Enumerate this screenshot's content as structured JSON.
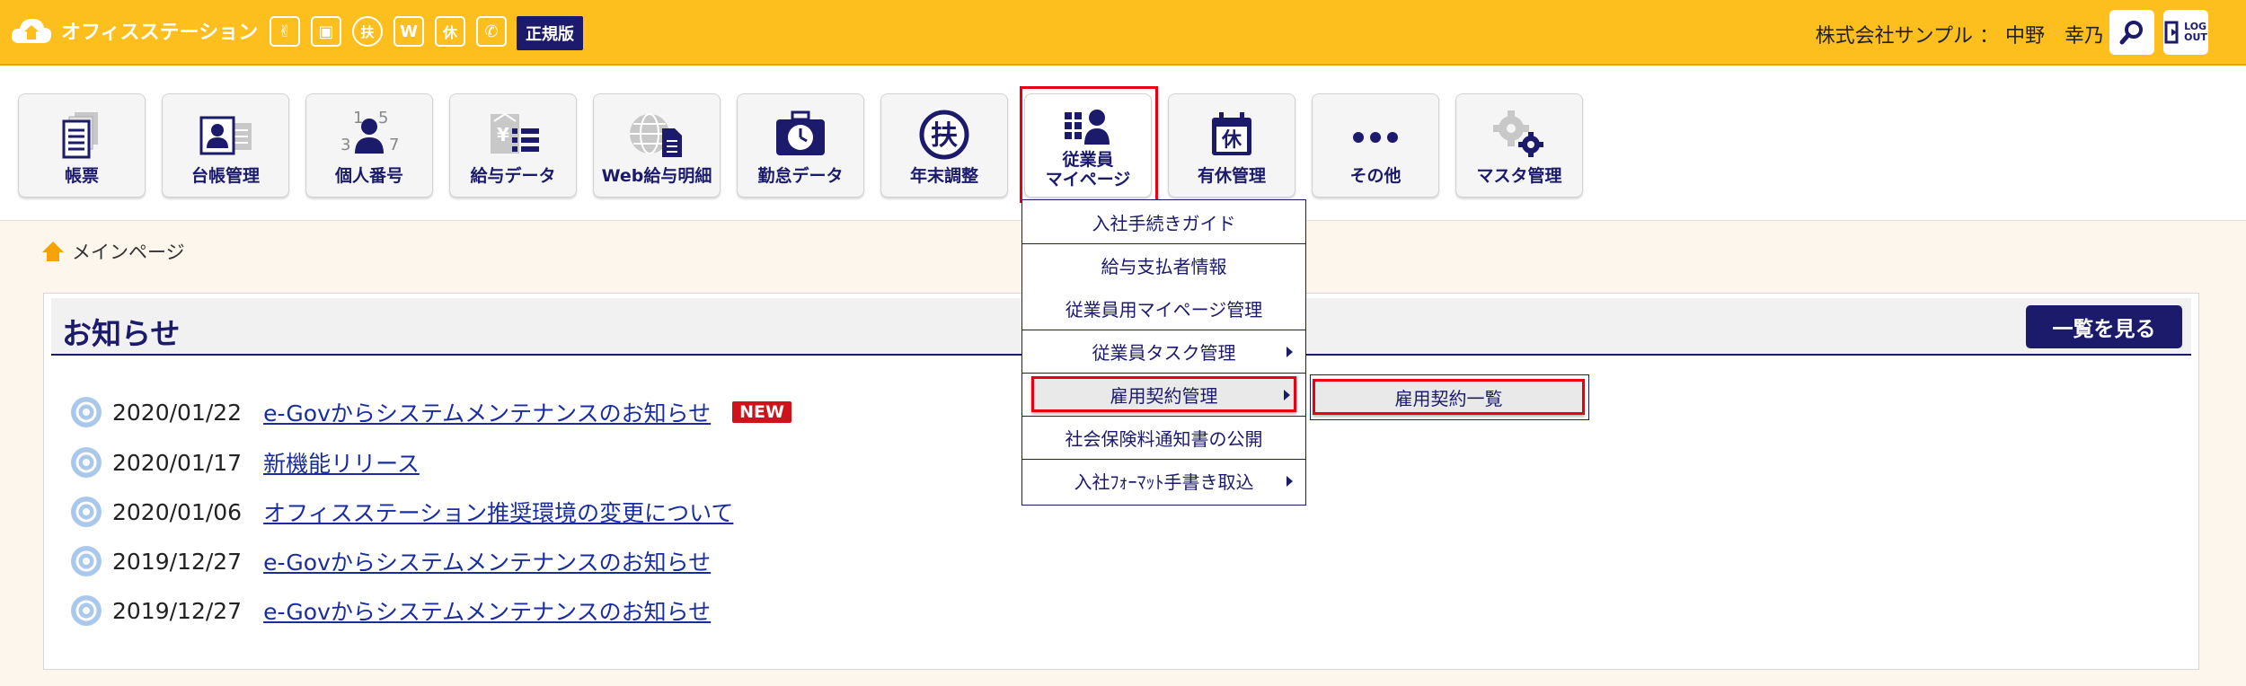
{
  "header": {
    "app_name": "オフィスステーション",
    "product_icons": [
      {
        "name": "victory-hand-icon",
        "glyph": "✌"
      },
      {
        "name": "briefcase-icon",
        "glyph": "▣"
      },
      {
        "name": "fu-icon",
        "glyph": "扶"
      },
      {
        "name": "web-payslip-icon",
        "glyph": "W"
      },
      {
        "name": "kyu-icon",
        "glyph": "休"
      },
      {
        "name": "phone-icon",
        "glyph": "✆"
      }
    ],
    "edition_badge": "正規版",
    "user": "株式会社サンプル ： 中野　幸乃",
    "logout_line1": "LOG",
    "logout_line2": "OUT",
    "accent_color": "#fcbf1e",
    "brand_color": "#1b1a6b"
  },
  "toolbar": {
    "items": [
      {
        "label": "帳票",
        "icon": "document-icon"
      },
      {
        "label": "台帳管理",
        "icon": "ledger-icon"
      },
      {
        "label": "個人番号",
        "icon": "personal-number-icon"
      },
      {
        "label": "給与データ",
        "icon": "salary-data-icon"
      },
      {
        "label": "Web給与明細",
        "icon": "web-payslip-icon"
      },
      {
        "label": "勤怠データ",
        "icon": "attendance-icon"
      },
      {
        "label": "年末調整",
        "icon": "year-end-icon"
      },
      {
        "label_line1": "従業員",
        "label_line2": "マイページ",
        "icon": "employee-mypage-icon",
        "active": true
      },
      {
        "label": "有休管理",
        "icon": "paid-leave-icon"
      },
      {
        "label": "その他",
        "icon": "more-icon"
      },
      {
        "label": "マスタ管理",
        "icon": "master-settings-icon"
      }
    ]
  },
  "dropdown": {
    "items": [
      {
        "label": "入社手続きガイド"
      },
      {
        "label": "給与支払者情報"
      },
      {
        "label": "従業員用マイページ管理"
      },
      {
        "label": "従業員タスク管理",
        "has_submenu": true
      },
      {
        "label": "雇用契約管理",
        "has_submenu": true,
        "highlighted": true
      },
      {
        "label": "社会保険料通知書の公開"
      },
      {
        "label": "入社ﾌｫｰﾏｯﾄ手書き取込",
        "has_submenu": true
      }
    ],
    "submenu": {
      "label": "雇用契約一覧"
    }
  },
  "breadcrumb": {
    "label": "メインページ"
  },
  "news": {
    "title": "お知らせ",
    "view_all": "一覧を見る",
    "new_badge": "NEW",
    "items": [
      {
        "date": "2020/01/22",
        "title": "e-Govからシステムメンテナンスのお知らせ",
        "is_new": true
      },
      {
        "date": "2020/01/17",
        "title": "新機能リリース"
      },
      {
        "date": "2020/01/06",
        "title": "オフィスステーション推奨環境の変更について"
      },
      {
        "date": "2019/12/27",
        "title": "e-Govからシステムメンテナンスのお知らせ"
      },
      {
        "date": "2019/12/27",
        "title": "e-Govからシステムメンテナンスのお知らせ"
      }
    ]
  }
}
